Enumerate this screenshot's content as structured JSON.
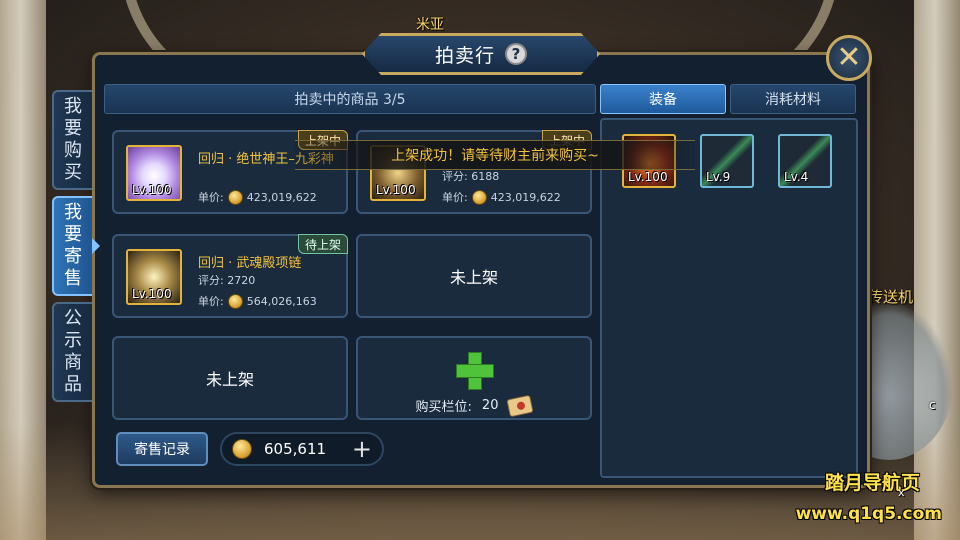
{
  "scene": {
    "top_label": "米亚",
    "side_label": "传送机",
    "edge_char": "c",
    "edge_char2": "x"
  },
  "window": {
    "title": "拍卖行",
    "help_icon": "?",
    "close_icon": "close-icon"
  },
  "side_tabs": [
    {
      "label": [
        "我",
        "要",
        "购",
        "买"
      ],
      "active": false
    },
    {
      "label": [
        "我",
        "要",
        "寄",
        "售"
      ],
      "active": true
    },
    {
      "label": [
        "公",
        "示",
        "商",
        "品"
      ],
      "active": false
    }
  ],
  "listing": {
    "header": "拍卖中的商品 3/5",
    "slots": [
      {
        "name": "回归 · 绝世神王–九彩神",
        "status": "上架中",
        "level": "Lv.100",
        "price_label": "单价:",
        "price": "423,019,622"
      },
      {
        "name": "",
        "status": "上架中",
        "level": "Lv.100",
        "score": "评分: 6188",
        "price_label": "单价:",
        "price": "423,019,622"
      },
      {
        "name": "回归 · 武魂殿项链",
        "status": "待上架",
        "level": "Lv.100",
        "score": "评分: 2720",
        "price_label": "单价:",
        "price": "564,026,163"
      },
      {
        "empty_label": "未上架"
      },
      {
        "empty_label": "未上架"
      },
      {
        "buy_label": "购买栏位:",
        "buy_count": "20"
      }
    ],
    "record_button": "寄售记录",
    "gold": "605,611",
    "gold_plus": "+"
  },
  "inventory": {
    "tabs": [
      {
        "label": "装备",
        "active": true
      },
      {
        "label": "消耗材料",
        "active": false
      }
    ],
    "items": [
      {
        "level": "Lv.100",
        "icon": "flame-gear-icon",
        "frame": "#e3b33c"
      },
      {
        "level": "Lv.9",
        "icon": "green-sword-icon",
        "frame": "#6fb8d8"
      },
      {
        "level": "Lv.4",
        "icon": "green-sword-icon",
        "frame": "#6fb8d8"
      }
    ]
  },
  "toast": "上架成功！请等待财主前来购买~",
  "watermark": {
    "line1": "踏月导航页",
    "line2": "www.q1q5.com"
  },
  "colors": {
    "gold_text": "#f2c23b",
    "accent_blue": "#2f74b8",
    "frame_gold": "#c9a860",
    "panel_bg": "#13202f"
  }
}
